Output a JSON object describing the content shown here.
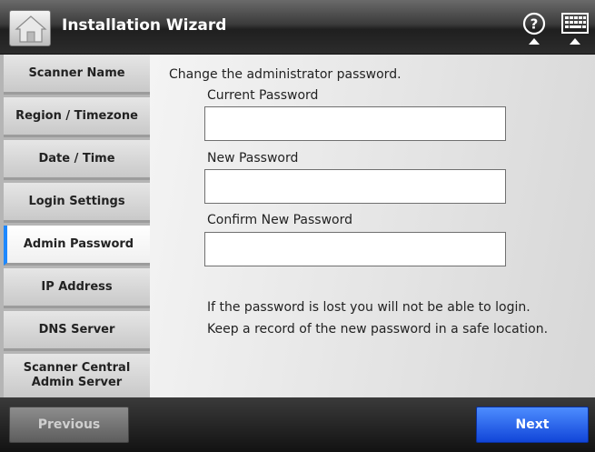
{
  "header": {
    "title": "Installation Wizard"
  },
  "sidebar": {
    "items": [
      {
        "label": "Scanner Name"
      },
      {
        "label": "Region / Timezone"
      },
      {
        "label": "Date / Time"
      },
      {
        "label": "Login Settings"
      },
      {
        "label": "Admin Password",
        "active": true
      },
      {
        "label": "IP Address"
      },
      {
        "label": "DNS Server"
      },
      {
        "label": "Scanner Central\nAdmin Server"
      }
    ]
  },
  "main": {
    "instruction": "Change the administrator password.",
    "current_password_label": "Current Password",
    "current_password_value": "",
    "new_password_label": "New Password",
    "new_password_value": "",
    "confirm_password_label": "Confirm New Password",
    "confirm_password_value": "",
    "notice_line1": "If the password is lost you will not be able to login.",
    "notice_line2": "Keep a record of the new password in a safe location."
  },
  "footer": {
    "previous_label": "Previous",
    "next_label": "Next"
  },
  "colors": {
    "accent": "#1e88ff",
    "next_button": "#1f5cf0"
  },
  "icons": [
    "home-icon",
    "help-icon",
    "keyboard-icon"
  ]
}
